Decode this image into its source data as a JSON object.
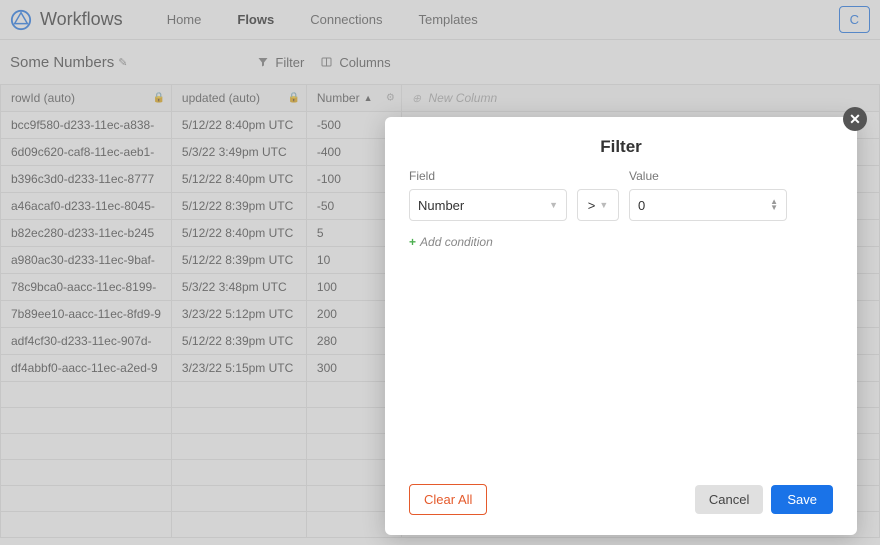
{
  "brand": "Workflows",
  "nav": {
    "home": "Home",
    "flows": "Flows",
    "connections": "Connections",
    "templates": "Templates"
  },
  "create_hint": "C",
  "table": {
    "title": "Some Numbers",
    "tools": {
      "filter": "Filter",
      "columns": "Columns"
    },
    "headers": {
      "rowid": "rowId (auto)",
      "updated": "updated (auto)",
      "number": "Number",
      "newcol": "New Column"
    },
    "rows": [
      {
        "rowid": "bcc9f580-d233-11ec-a838-",
        "updated": "5/12/22 8:40pm UTC",
        "number": "-500"
      },
      {
        "rowid": "6d09c620-caf8-11ec-aeb1-",
        "updated": "5/3/22 3:49pm UTC",
        "number": "-400"
      },
      {
        "rowid": "b396c3d0-d233-11ec-8777",
        "updated": "5/12/22 8:40pm UTC",
        "number": "-100"
      },
      {
        "rowid": "a46acaf0-d233-11ec-8045-",
        "updated": "5/12/22 8:39pm UTC",
        "number": "-50"
      },
      {
        "rowid": "b82ec280-d233-11ec-b245",
        "updated": "5/12/22 8:40pm UTC",
        "number": "5"
      },
      {
        "rowid": "a980ac30-d233-11ec-9baf-",
        "updated": "5/12/22 8:39pm UTC",
        "number": "10"
      },
      {
        "rowid": "78c9bca0-aacc-11ec-8199-",
        "updated": "5/3/22 3:48pm UTC",
        "number": "100"
      },
      {
        "rowid": "7b89ee10-aacc-11ec-8fd9-9",
        "updated": "3/23/22 5:12pm UTC",
        "number": "200"
      },
      {
        "rowid": "adf4cf30-d233-11ec-907d-",
        "updated": "5/12/22 8:39pm UTC",
        "number": "280"
      },
      {
        "rowid": "df4abbf0-aacc-11ec-a2ed-9",
        "updated": "3/23/22 5:15pm UTC",
        "number": "300"
      }
    ]
  },
  "modal": {
    "title": "Filter",
    "field_label": "Field",
    "value_label": "Value",
    "field_value": "Number",
    "operator": ">",
    "value": "0",
    "add_condition": "Add condition",
    "clear": "Clear All",
    "cancel": "Cancel",
    "save": "Save"
  }
}
